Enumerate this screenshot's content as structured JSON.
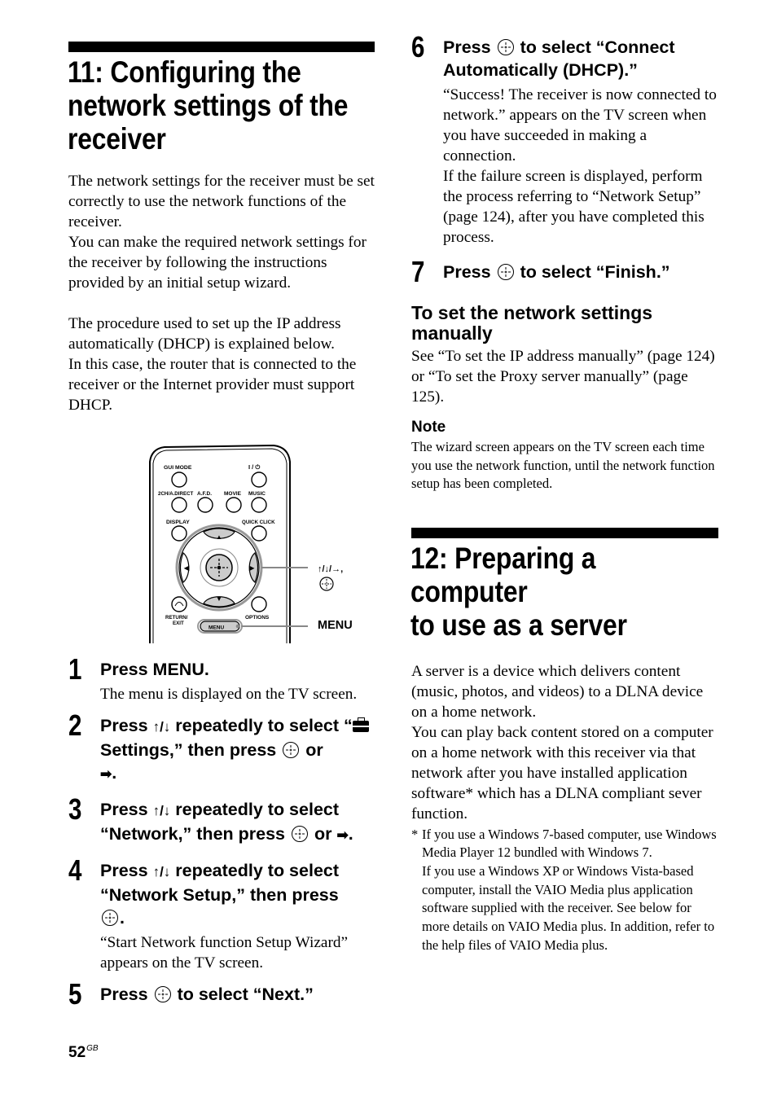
{
  "section11": {
    "title_lines": [
      "11: Configuring the",
      "network settings of the",
      "receiver"
    ],
    "intro": [
      "The network settings for the receiver must be set correctly to use the network functions of the receiver.",
      "You can make the required network settings for the receiver by following the instructions provided by an initial setup wizard."
    ],
    "procedure": [
      "The procedure used to set up the IP address automatically (DHCP) is explained below.",
      "In this case, the router that is connected to the receiver or the Internet provider must support DHCP."
    ]
  },
  "remote": {
    "buttons": {
      "gui_mode": "GUI MODE",
      "power": "I / ⏻",
      "two_ch": "2CH/A.DIRECT",
      "afd": "A.F.D.",
      "movie": "MOVIE",
      "music": "MUSIC",
      "display": "DISPLAY",
      "quick_click": "QUICK CLICK",
      "return_exit_1": "RETURN/",
      "return_exit_2": "EXIT",
      "options": "OPTIONS",
      "menu": "MENU"
    },
    "callouts": {
      "arrows": "↑/↓/→,",
      "menu": "MENU"
    }
  },
  "steps": [
    {
      "num": "1",
      "head": "Press MENU.",
      "body": "The menu is displayed on the TV screen."
    },
    {
      "num": "2",
      "head_a": "Press ",
      "arrows": "↑/↓",
      "head_b": " repeatedly to select “",
      "icon_label": "Settings,” then press",
      "head_c": " or",
      "tail": "."
    },
    {
      "num": "3",
      "head_a": "Press ",
      "arrows": "↑/↓",
      "head_b": " repeatedly to select “Network,” then press",
      "head_c": " or ",
      "tail": "."
    },
    {
      "num": "4",
      "head_a": "Press ",
      "arrows": "↑/↓",
      "head_b": " repeatedly to select “Network Setup,” then press",
      "tail": ".",
      "body": "“Start Network function Setup Wizard” appears on the TV screen."
    },
    {
      "num": "5",
      "head_a": "Press",
      "head_b": "to select “Next.”"
    },
    {
      "num": "6",
      "head_a": "Press",
      "head_b": "to select “Connect Automatically (DHCP).”",
      "body_1": "“Success! The receiver is now connected to network.” appears on the TV screen when you have succeeded in making a connection.",
      "body_2": "If the failure screen is displayed, perform the process referring to “Network Setup” (page 124), after you have completed this process."
    },
    {
      "num": "7",
      "head_a": "Press",
      "head_b": "to select “Finish.”"
    }
  ],
  "manual": {
    "heading": "To set the network settings manually",
    "body": "See “To set the IP address manually” (page 124) or “To set the Proxy server manually” (page 125)."
  },
  "note": {
    "heading": "Note",
    "body": "The wizard screen appears on the TV screen each time you use the network function, until the network function setup has been completed."
  },
  "section12": {
    "title_lines": [
      "12: Preparing a computer",
      "to use as a server"
    ],
    "p1": "A server is a device which delivers content (music, photos, and videos) to a DLNA device on a home network.",
    "p2": "You can play back content stored on a computer on a home network with this receiver via that network after you have installed application software* which has a DLNA compliant sever function.",
    "footnote_mark": "*",
    "footnote_1": "If you use a Windows 7-based computer, use Windows Media Player 12 bundled with Windows 7.",
    "footnote_2": "If you use a Windows XP or Windows Vista-based computer, install the VAIO Media plus application software supplied with the receiver. See below for more details on VAIO Media plus. In addition, refer to the help files of VAIO Media plus."
  },
  "footer": {
    "page": "52",
    "suffix": "GB"
  }
}
